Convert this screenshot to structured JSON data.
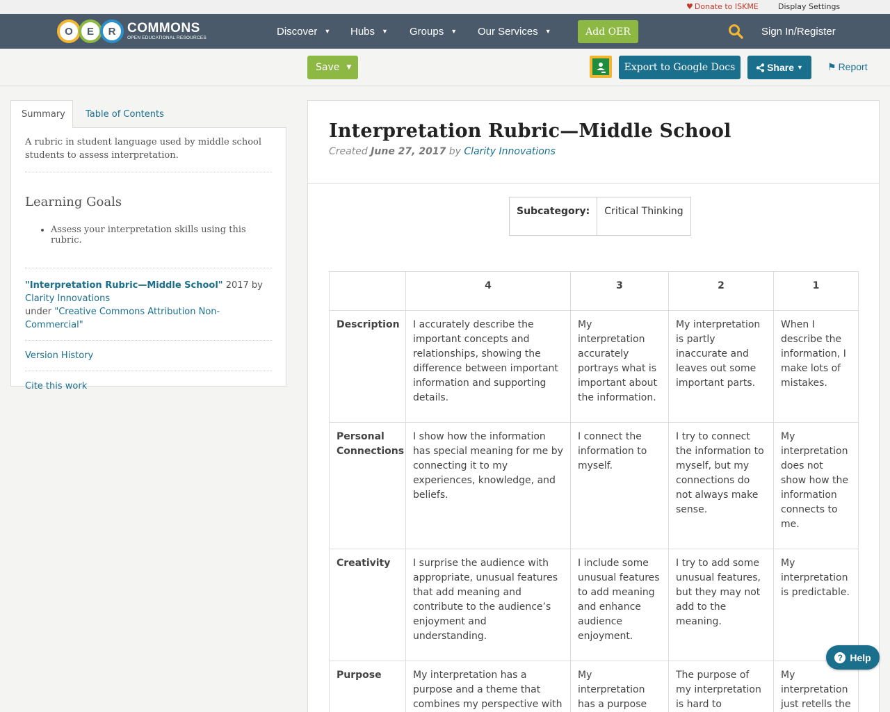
{
  "util": {
    "donate": "Donate to ISKME",
    "display_settings": "Display Settings"
  },
  "logo": {
    "letters": [
      "O",
      "E",
      "R"
    ],
    "word": "COMMONS",
    "sub": "OPEN EDUCATIONAL RESOURCES"
  },
  "nav": {
    "items": [
      {
        "label": "Discover",
        "icon": "chevron-down-icon"
      },
      {
        "label": "Hubs",
        "icon": "chevron-down-icon"
      },
      {
        "label": "Groups",
        "icon": "chevron-down-icon"
      },
      {
        "label": "Our Services",
        "icon": "chevron-down-icon"
      }
    ],
    "add_oer": "Add OER",
    "search_icon": "search-icon",
    "signin": "Sign In/Register"
  },
  "actions": {
    "save": "Save",
    "export": "Export to Google Docs",
    "share": "Share",
    "report": "Report"
  },
  "sidebar": {
    "tabs": [
      "Summary",
      "Table of Contents"
    ],
    "summary": "A rubric in student language used by middle school students to assess interpretation.",
    "learning_goals_heading": "Learning Goals",
    "learning_goals": [
      "Assess your interpretation skills using this rubric."
    ],
    "attribution": {
      "title": "\"Interpretation Rubric—Middle School\"",
      "year": " 2017 by ",
      "author": "Clarity Innovations",
      "under": "under ",
      "license": "\"Creative Commons Attribution Non-Commercial\""
    },
    "version_history": "Version History",
    "cite": "Cite this work"
  },
  "main": {
    "title": "Interpretation Rubric—Middle School",
    "created_label": "Created ",
    "created_date": "June 27, 2017",
    "by_label": " by ",
    "author": "Clarity Innovations",
    "subcategory_key": "Subcategory:",
    "subcategory_value": "Critical Thinking"
  },
  "rubric": {
    "headers": [
      "",
      "4",
      "3",
      "2",
      "1"
    ],
    "rows": [
      {
        "label": "Description",
        "cells": [
          "I accurately describe the important concepts and relationships, showing the difference between important information and supporting details.",
          "My interpretation accurately portrays what is important about the information.",
          "My interpretation is partly inaccurate and leaves out some important parts.",
          "When I describe the information, I make lots of mistakes."
        ]
      },
      {
        "label": "Personal Connections",
        "cells": [
          "I show how the information has special meaning for me by connecting it to my experiences, knowledge, and beliefs.",
          "I connect the information to myself.",
          "I try to connect the information to myself, but my connections do not always make sense.",
          "My interpretation does not show how the information connects to me."
        ]
      },
      {
        "label": "Creativity",
        "cells": [
          "I surprise the audience with appropriate, unusual features that add meaning and contribute to the audience’s enjoyment and understanding.",
          "I include some unusual features to add meaning and enhance audience enjoyment.",
          "I try to add some unusual features, but they may not add to the meaning.",
          "My interpretation is predictable."
        ]
      },
      {
        "label": "Purpose",
        "cells": [
          "My interpretation has a purpose and a theme that combines my perspective with the facts.",
          "My interpretation has a purpose and shows",
          "The purpose of my interpretation is hard to",
          "My interpretation just retells the"
        ]
      }
    ]
  },
  "help": "Help"
}
